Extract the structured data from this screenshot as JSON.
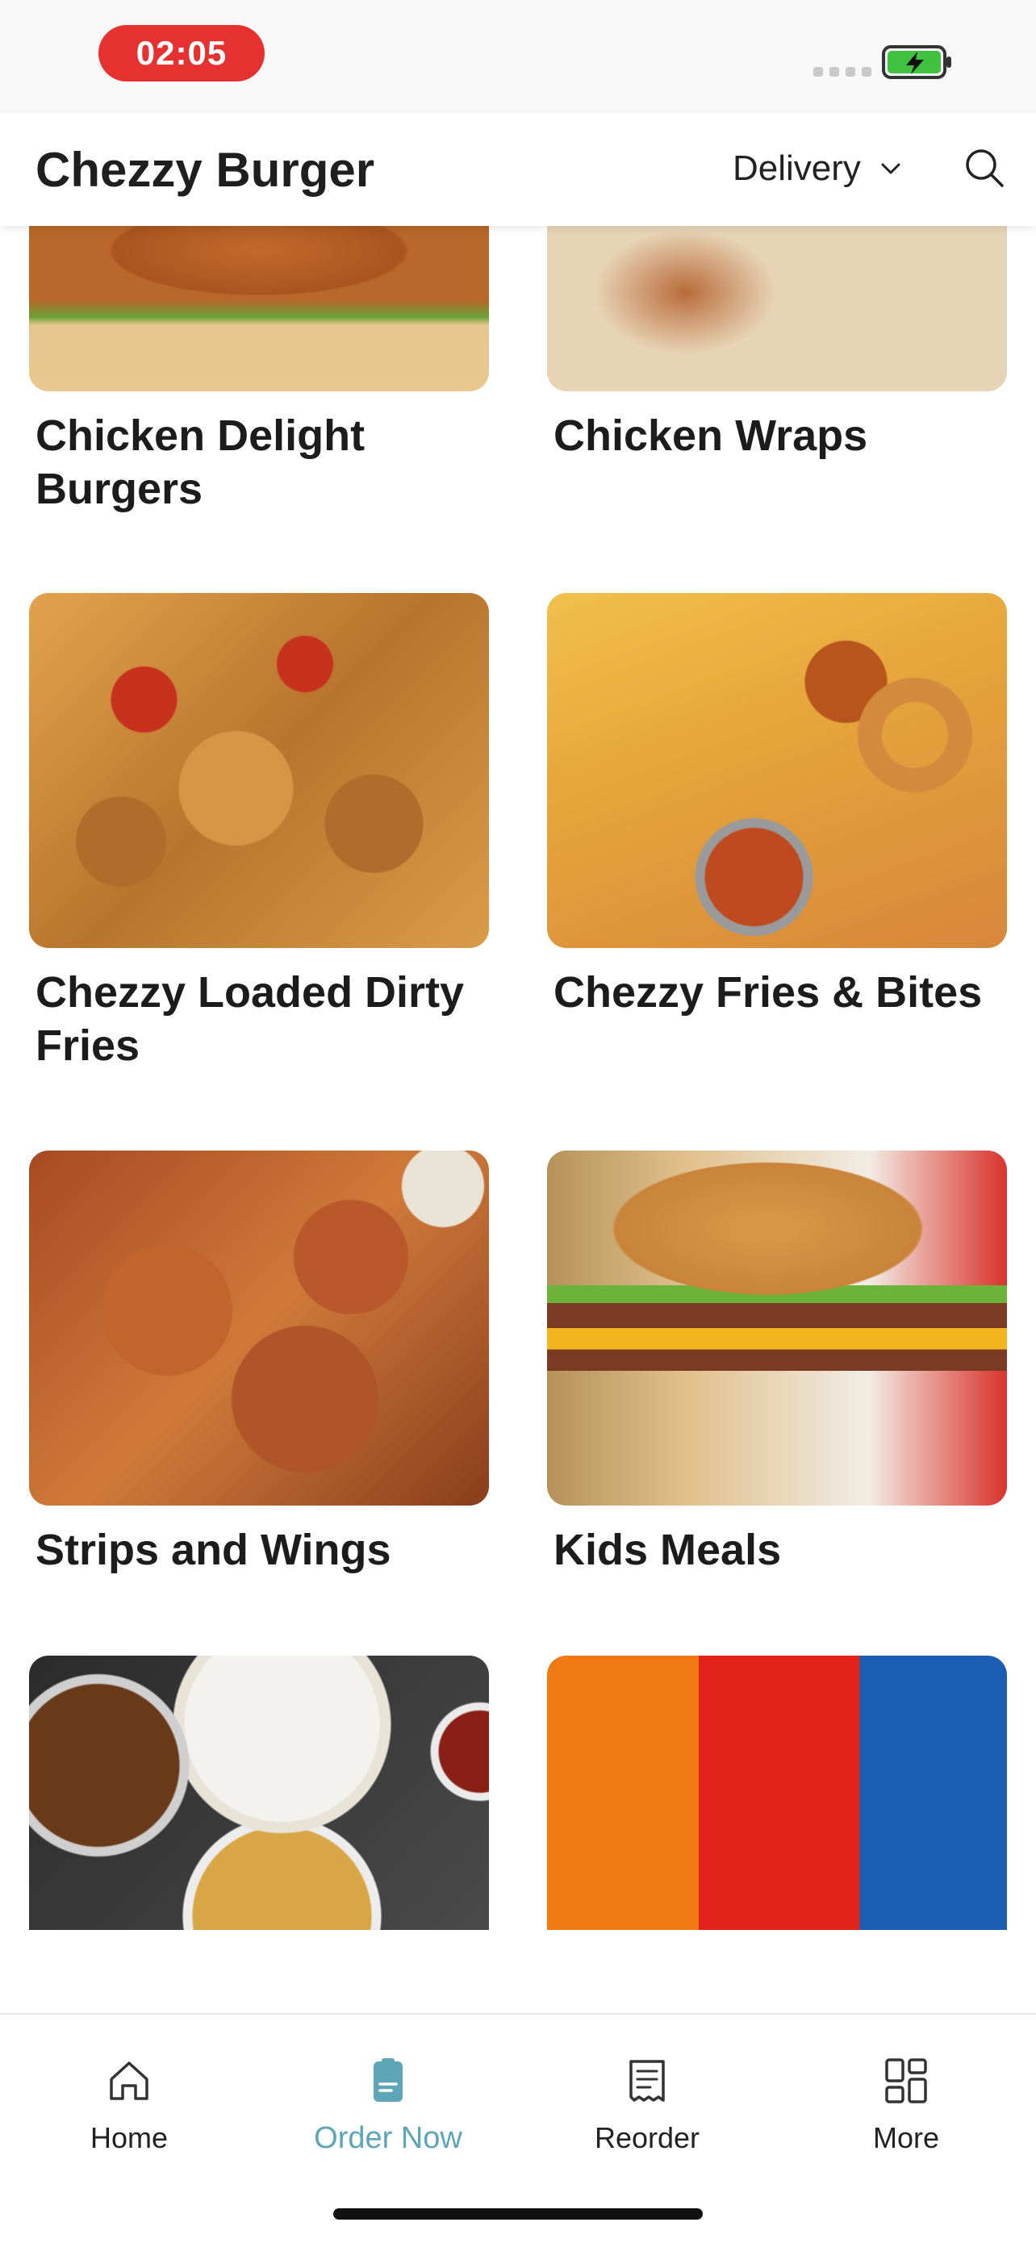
{
  "status_bar": {
    "time": "02:05"
  },
  "header": {
    "title": "Chezzy Burger",
    "order_mode": "Delivery"
  },
  "menu": {
    "categories": [
      {
        "name": "Chicken Delight Burgers"
      },
      {
        "name": "Chicken Wraps"
      },
      {
        "name": "Chezzy Loaded Dirty Fries"
      },
      {
        "name": "Chezzy Fries & Bites"
      },
      {
        "name": "Strips and Wings"
      },
      {
        "name": "Kids Meals"
      },
      {
        "name": ""
      },
      {
        "name": ""
      }
    ]
  },
  "bottom_nav": {
    "items": [
      {
        "label": "Home",
        "icon": "home-icon"
      },
      {
        "label": "Order Now",
        "icon": "order-icon",
        "active": true
      },
      {
        "label": "Reorder",
        "icon": "receipt-icon"
      },
      {
        "label": "More",
        "icon": "grid-icon"
      }
    ]
  },
  "colors": {
    "time_pill": "#e5312f",
    "active_tab": "#5ea6b7",
    "battery": "#3fc23f"
  }
}
